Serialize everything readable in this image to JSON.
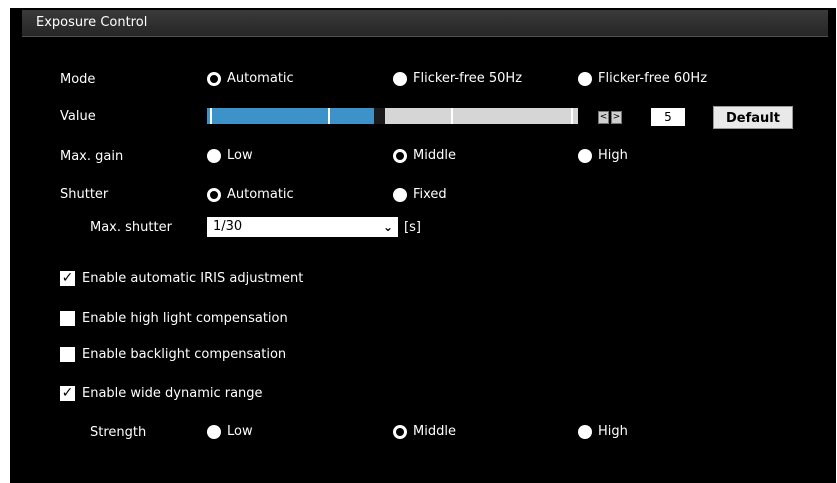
{
  "title": "Exposure Control",
  "mode": {
    "label": "Mode",
    "options": [
      "Automatic",
      "Flicker-free 50Hz",
      "Flicker-free 60Hz"
    ],
    "selected": "Automatic"
  },
  "value": {
    "label": "Value",
    "current": "5",
    "slider_fraction": 0.45,
    "dec_label": "<",
    "inc_label": ">",
    "default_label": "Default"
  },
  "max_gain": {
    "label": "Max. gain",
    "options": [
      "Low",
      "Middle",
      "High"
    ],
    "selected": "Middle"
  },
  "shutter": {
    "label": "Shutter",
    "options": [
      "Automatic",
      "Fixed"
    ],
    "selected": "Automatic",
    "max_label": "Max. shutter",
    "max_value": "1/30",
    "unit": "[s]"
  },
  "checks": {
    "iris": {
      "label": "Enable automatic IRIS adjustment",
      "checked": true
    },
    "highlight": {
      "label": "Enable high light compensation",
      "checked": false
    },
    "backlight": {
      "label": "Enable backlight compensation",
      "checked": false
    },
    "wdr": {
      "label": "Enable wide dynamic range",
      "checked": true
    }
  },
  "strength": {
    "label": "Strength",
    "options": [
      "Low",
      "Middle",
      "High"
    ],
    "selected": "Middle"
  },
  "colors": {
    "slider_fill": "#3d92c9",
    "slider_rest": "#d6d6d6",
    "panel_bg": "#000000"
  }
}
